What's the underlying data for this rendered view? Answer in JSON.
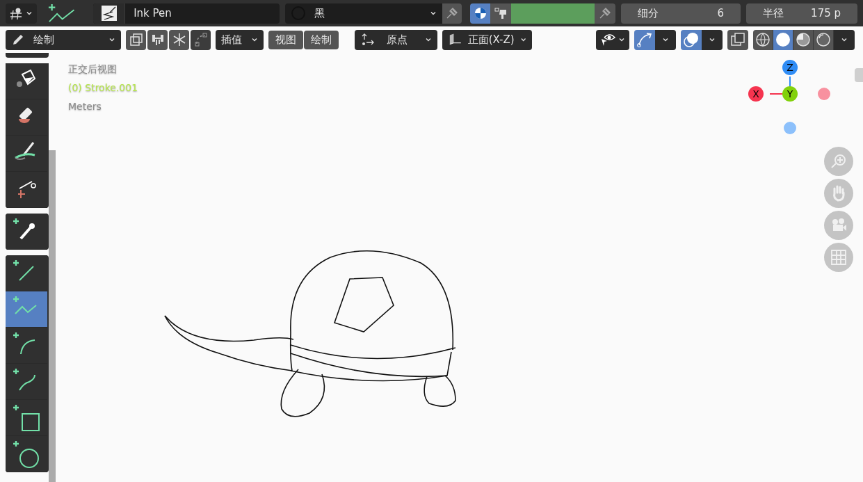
{
  "top_bar": {
    "brush": {
      "name": "Ink Pen"
    },
    "material": {
      "name": "黑"
    },
    "color_mode_selected": true,
    "fields": [
      {
        "label": "细分",
        "value": "6"
      },
      {
        "label": "半径",
        "value": "175 p"
      }
    ]
  },
  "header": {
    "mode": "绘制",
    "interpolate": "插值",
    "menus": [
      "视图",
      "绘制"
    ],
    "pivot": "原点",
    "orientation": "正面(X-Z)",
    "toggles": [
      {
        "kind": "gizmo",
        "selected": true
      },
      {
        "kind": "overlay",
        "selected": true
      },
      {
        "kind": "xray",
        "selected": false
      }
    ],
    "shading": [
      {
        "kind": "wireframe",
        "selected": false
      },
      {
        "kind": "solid",
        "selected": true
      },
      {
        "kind": "material",
        "selected": false
      },
      {
        "kind": "rendered",
        "selected": false
      }
    ]
  },
  "toolbar": [
    [
      {
        "kind": "fill",
        "selected": false
      },
      {
        "kind": "erase",
        "selected": false
      },
      {
        "kind": "tint",
        "selected": false
      },
      {
        "kind": "cutter",
        "selected": false
      }
    ],
    [
      {
        "kind": "eyedropper",
        "selected": false
      }
    ],
    [
      {
        "kind": "line",
        "selected": false
      },
      {
        "kind": "polyline",
        "selected": true
      },
      {
        "kind": "arc",
        "selected": false
      },
      {
        "kind": "curve",
        "selected": false
      },
      {
        "kind": "box",
        "selected": false
      },
      {
        "kind": "circle",
        "selected": false
      }
    ]
  ],
  "viewport": {
    "view_name": "正交后视图",
    "object": "(0) Stroke.001",
    "units": "Meters",
    "axes": [
      {
        "label": "Z",
        "color": "#2f8cf5"
      },
      {
        "label": "X",
        "color": "#f5344f"
      },
      {
        "label": "Y",
        "color": "#82d10c"
      }
    ]
  }
}
